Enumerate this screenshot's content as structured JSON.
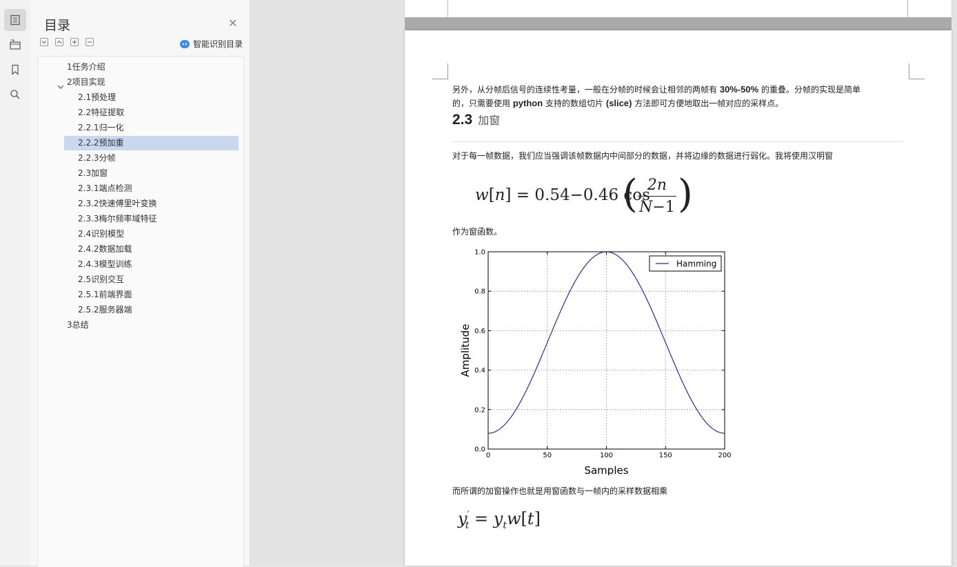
{
  "sidebar": {
    "icons": [
      "toc-icon",
      "nav-pane-icon",
      "bookmark-icon",
      "search-icon"
    ]
  },
  "toc": {
    "title": "目录",
    "smart_label": "智能识别目录",
    "selected_index": 5,
    "items": [
      {
        "label": "1任务介绍",
        "level": 1
      },
      {
        "label": "2项目实现",
        "level": 1,
        "expanded": true
      },
      {
        "label": "2.1预处理",
        "level": 2
      },
      {
        "label": "2.2特征提取",
        "level": 2
      },
      {
        "label": "2.2.1归一化",
        "level": 2
      },
      {
        "label": "2.2.2预加重",
        "level": 2
      },
      {
        "label": "2.2.3分帧",
        "level": 2
      },
      {
        "label": "2.3加窗",
        "level": 2
      },
      {
        "label": "2.3.1端点检测",
        "level": 2
      },
      {
        "label": "2.3.2快速傅里叶变换",
        "level": 2
      },
      {
        "label": "2.3.3梅尔频率域特征",
        "level": 2
      },
      {
        "label": "2.4识别模型",
        "level": 2
      },
      {
        "label": "2.4.2数据加载",
        "level": 2
      },
      {
        "label": "2.4.3模型训练",
        "level": 2
      },
      {
        "label": "2.5识别交互",
        "level": 2
      },
      {
        "label": "2.5.1前端界面",
        "level": 2
      },
      {
        "label": "2.5.2服务器端",
        "level": 2
      },
      {
        "label": "3总结",
        "level": 1
      }
    ]
  },
  "document": {
    "para1": {
      "a": "另外，从分帧后信号的连续性考量，一般在分帧的时候会让相邻的两帧有",
      "b": "30%-50%",
      "c": "的重叠。分帧的实现是简单",
      "d": "的，只需要使用",
      "e": "python",
      "f": "支持的数组切片",
      "g": "(slice)",
      "h": "方法即可方便地取出一帧对应的采样点。"
    },
    "heading_num": "2.3",
    "heading_text": "加窗",
    "para2": "对于每一帧数据，我们应当强调该帧数据内中间部分的数据，并将边缘的数据进行弱化。我将使用汉明窗",
    "formula1": {
      "lhs_w": "w",
      "lhs_n": "n",
      "c1": "0.54",
      "c2": "0.46",
      "cos": "cos",
      "num": "2n",
      "den_N": "N",
      "den_1": "1"
    },
    "para3": "作为窗函数。",
    "para4": "而所谓的加窗操作也就是用窗函数与一帧内的采样数据相乘",
    "formula2": {
      "y": "y",
      "t": "t",
      "w": "w"
    }
  },
  "chart_data": {
    "type": "line",
    "xlabel": "Samples",
    "ylabel": "Amplitude",
    "xlim": [
      0,
      200
    ],
    "ylim": [
      0.0,
      1.0
    ],
    "xticks": [
      "0",
      "50",
      "100",
      "150",
      "200"
    ],
    "yticks": [
      "0.0",
      "0.2",
      "0.4",
      "0.6",
      "0.8",
      "1.0"
    ],
    "grid": true,
    "legend": "top-right",
    "series": [
      {
        "name": "Hamming",
        "color": "#2a2aa8",
        "function": "0.54-0.46*cos(2*pi*n/200)",
        "n_points": 201,
        "x": [
          0,
          25,
          50,
          75,
          100,
          125,
          150,
          175,
          200
        ],
        "y": [
          0.08,
          0.21,
          0.54,
          0.86,
          1.0,
          0.86,
          0.54,
          0.21,
          0.08
        ]
      }
    ]
  }
}
